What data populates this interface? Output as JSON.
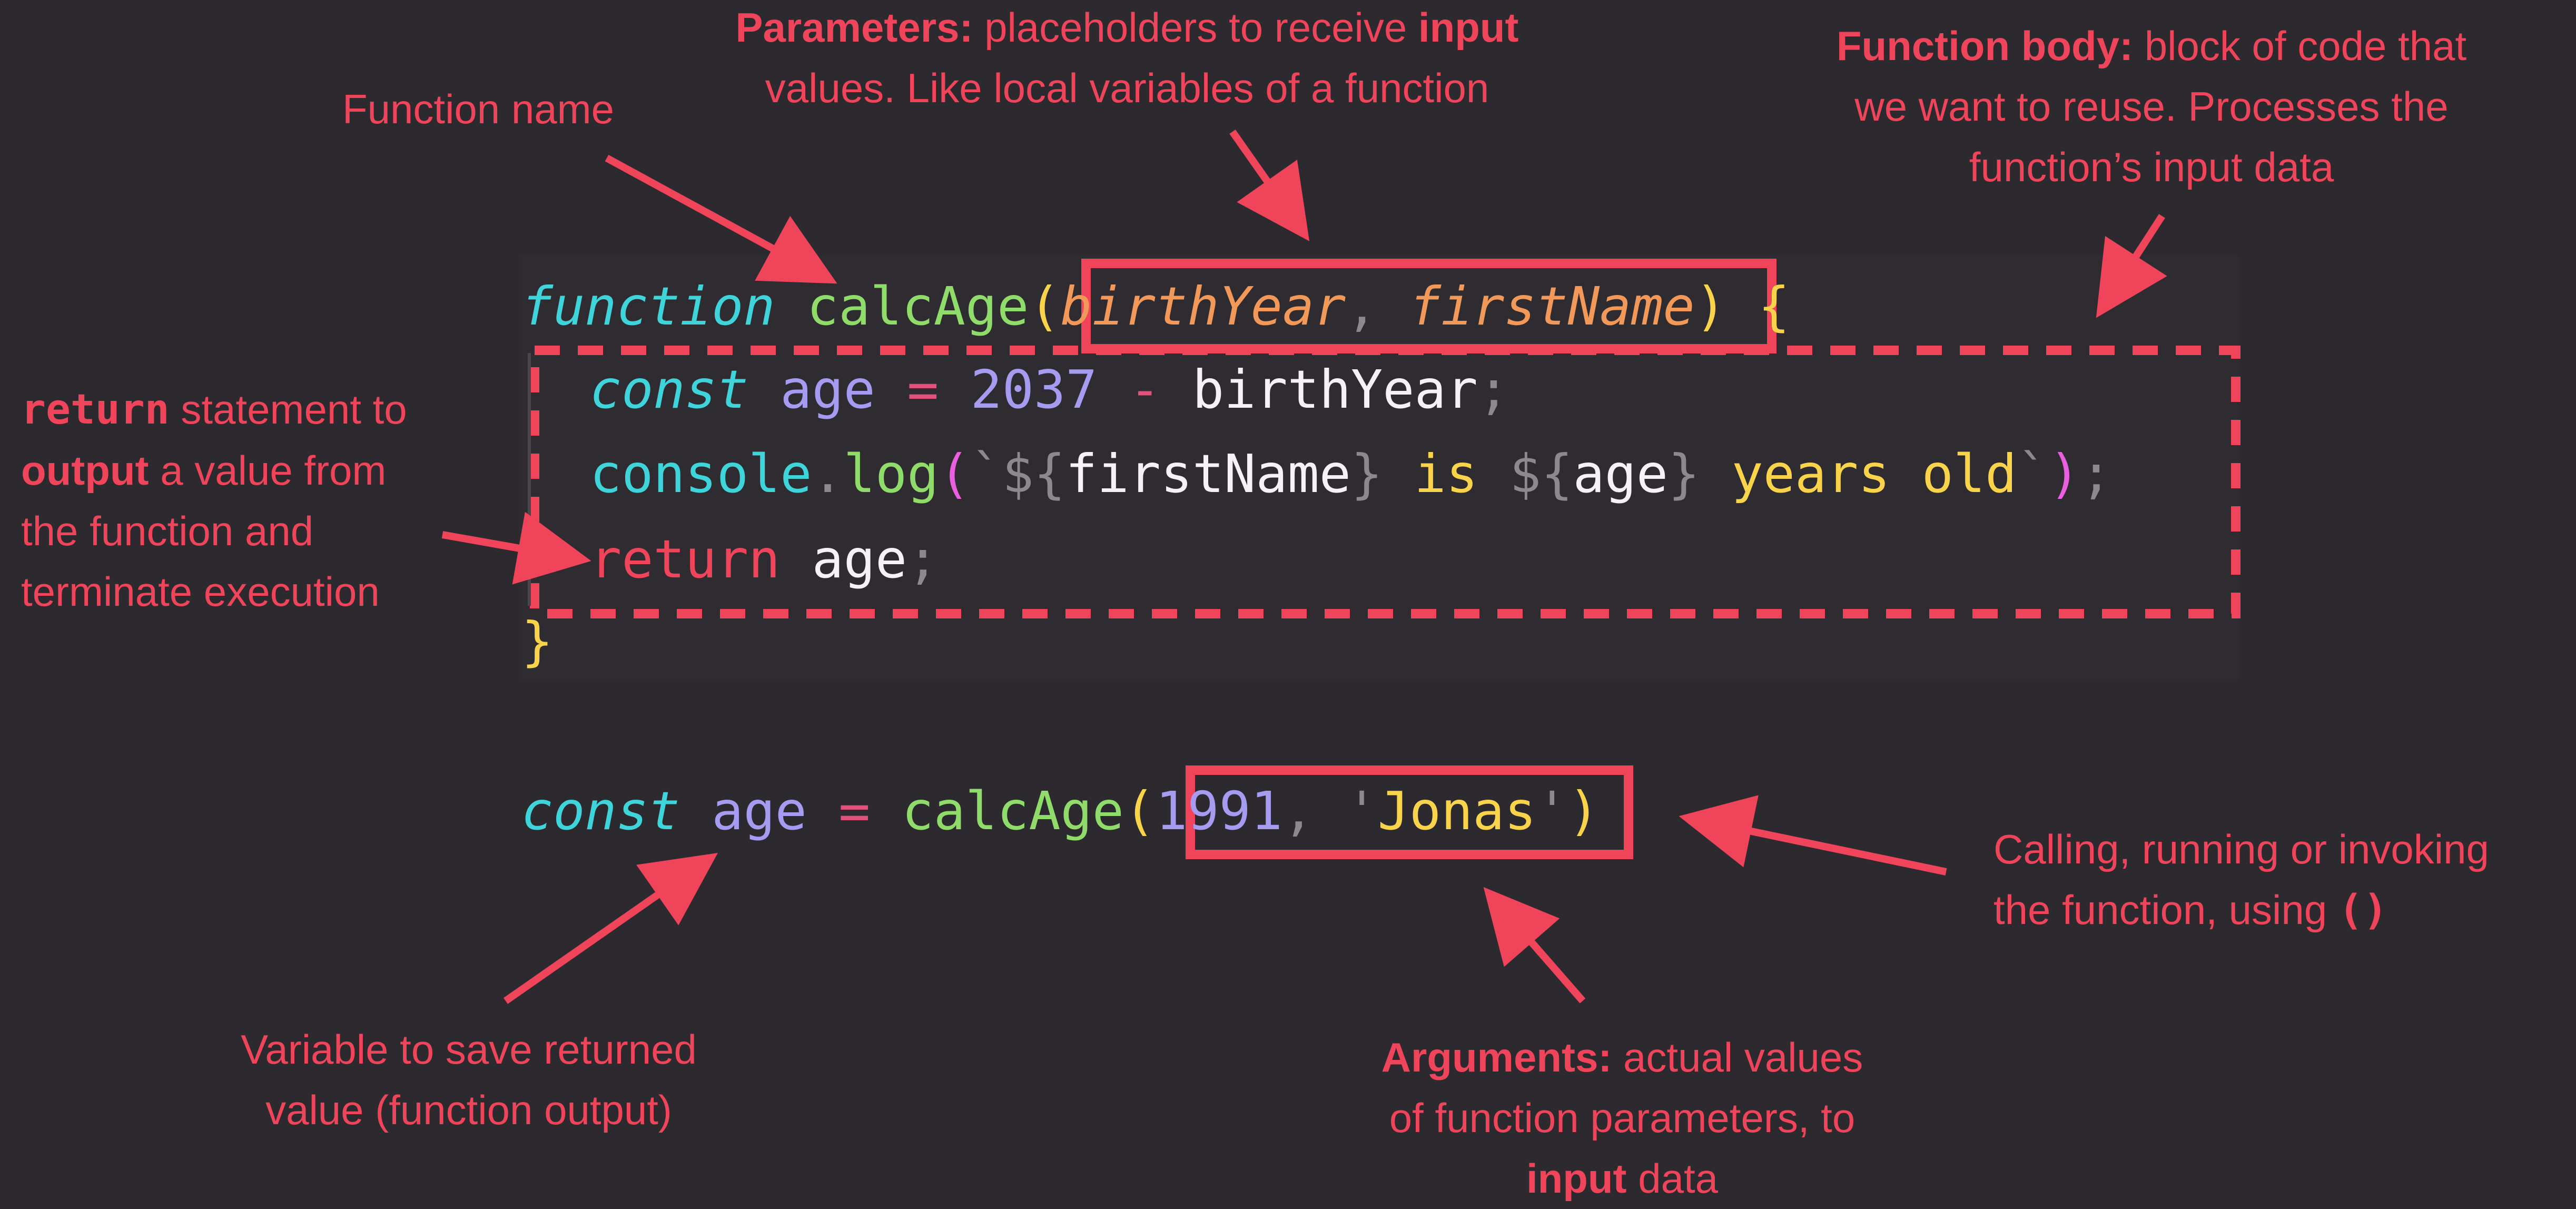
{
  "code": {
    "line1": {
      "kw": "function",
      "fn": "calcAge",
      "open": "(",
      "p1": "birthYear",
      "comma": ",",
      "p2": "firstName",
      "close": ")",
      "brace": "{"
    },
    "line2": {
      "kw": "const",
      "var": "age",
      "op": "=",
      "num": "2037",
      "minus": "-",
      "ref": "birthYear",
      "semi": ";"
    },
    "line3": {
      "obj": "console",
      "dot": ".",
      "fn": "log",
      "open": "(",
      "tick": "`",
      "d1": "${",
      "v1": "firstName",
      "c1": "}",
      "t1": " is ",
      "d2": "${",
      "v2": "age",
      "c2": "}",
      "t2": " years old",
      "tick2": "`",
      "close": ")",
      "semi": ";"
    },
    "line4": {
      "kw": "return",
      "var": "age",
      "semi": ";"
    },
    "line5": {
      "brace": "}"
    },
    "line6": {
      "kw": "const",
      "var": "age",
      "op": "=",
      "fn": "calcAge",
      "open": "(",
      "num": "1991",
      "comma": ",",
      "q1": "'",
      "str": "Jonas",
      "q2": "'",
      "close": ")"
    }
  },
  "annotations": {
    "function_name": "Function name",
    "parameters": {
      "bold": "Parameters:",
      "t1": " placeholders to receive ",
      "bold2": "input",
      "t2": "values. Like local variables of a function"
    },
    "body": {
      "bold": "Function body:",
      "t1": " block of code that",
      "t2": "we want to reuse. Processes the",
      "t3": "function’s input data"
    },
    "return": {
      "code": "return",
      "t1": " statement to",
      "bold": "output",
      "t2": " a value from",
      "t3": "the function and",
      "t4": "terminate execution"
    },
    "variable": {
      "t1": "Variable to save returned",
      "t2": "value (function output)"
    },
    "arguments": {
      "bold": "Arguments:",
      "t1": " actual values",
      "t2": "of function parameters, to",
      "bold2": "input",
      "t3": " data"
    },
    "calling": {
      "t1": "Calling, running or invoking",
      "t2": "the function, using ",
      "code": "()"
    }
  },
  "colors": {
    "background": "#2d2a2f",
    "accent": "#f0445b"
  }
}
